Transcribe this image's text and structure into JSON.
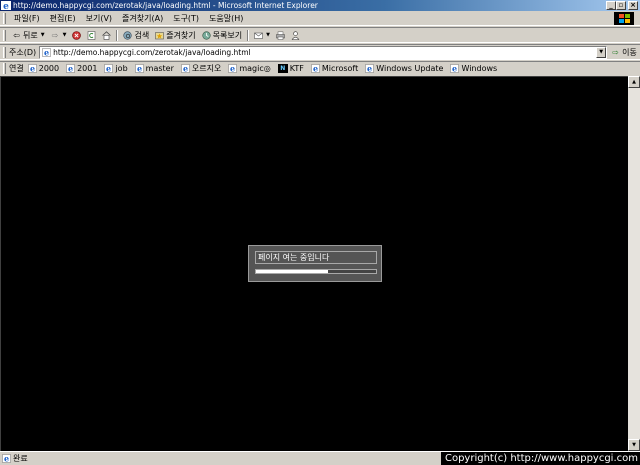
{
  "window": {
    "title": "http://demo.happycgi.com/zerotak/java/loading.html - Microsoft Internet Explorer",
    "minimize": "_",
    "restore": "▫",
    "close": "×"
  },
  "menu": {
    "items": [
      {
        "label": "파일(F)"
      },
      {
        "label": "편집(E)"
      },
      {
        "label": "보기(V)"
      },
      {
        "label": "즐겨찾기(A)"
      },
      {
        "label": "도구(T)"
      },
      {
        "label": "도움말(H)"
      }
    ]
  },
  "toolbar": {
    "back_label": "뒤로",
    "search_label": "검색",
    "favorites_label": "즐겨찾기",
    "history_label": "목록보기"
  },
  "address": {
    "label": "주소(D)",
    "url": "http://demo.happycgi.com/zerotak/java/loading.html",
    "go_label": "이동"
  },
  "links": {
    "label": "연결",
    "items": [
      {
        "label": "2000",
        "icon": "ie-page-icon"
      },
      {
        "label": "2001",
        "icon": "ie-page-icon"
      },
      {
        "label": "job",
        "icon": "ie-page-icon"
      },
      {
        "label": "master",
        "icon": "ie-page-icon"
      },
      {
        "label": "오르지오",
        "icon": "ie-page-icon"
      },
      {
        "label": "magic◎",
        "icon": "ie-page-icon"
      },
      {
        "label": "KTF",
        "icon": "ktf-icon"
      },
      {
        "label": "Microsoft",
        "icon": "ie-page-icon"
      },
      {
        "label": "Windows Update",
        "icon": "ie-page-icon"
      },
      {
        "label": "Windows",
        "icon": "ie-page-icon"
      }
    ],
    "ktf_icon_text": "N"
  },
  "loading": {
    "message": "페이지 여는 중입니다",
    "progress": 0.6
  },
  "status": {
    "text": "완료",
    "copyright": "Copyright(c) http://www.happycgi.com"
  },
  "colors": {
    "content_bg": "#000000",
    "titlebar_start": "#0a246a",
    "chrome": "#d4d0c8"
  }
}
